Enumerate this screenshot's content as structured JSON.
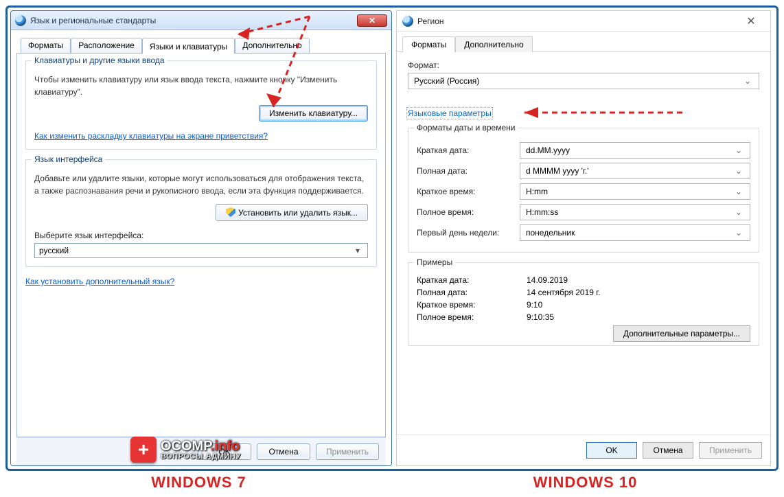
{
  "win7": {
    "title": "Язык и региональные стандарты",
    "tabs": [
      "Форматы",
      "Расположение",
      "Языки и клавиатуры",
      "Дополнительно"
    ],
    "active_tab_index": 2,
    "group_kb": {
      "legend": "Клавиатуры и другие языки ввода",
      "desc": "Чтобы изменить клавиатуру или язык ввода текста, нажмите кнопку \"Изменить клавиатуру\".",
      "btn": "Изменить клавиатуру...",
      "link": "Как изменить раскладку клавиатуры на экране приветствия?"
    },
    "group_ui": {
      "legend": "Язык интерфейса",
      "desc": "Добавьте или удалите языки, которые могут использоваться для отображения текста, а также распознавания речи и рукописного ввода, если эта функция поддерживается.",
      "btn": "Установить или удалить язык...",
      "select_label": "Выберите язык интерфейса:",
      "select_value": "русский"
    },
    "link_bottom": "Как установить дополнительный язык?",
    "footer": {
      "ok": "OK",
      "cancel": "Отмена",
      "apply": "Применить"
    }
  },
  "win10": {
    "title": "Регион",
    "tabs": [
      "Форматы",
      "Дополнительно"
    ],
    "active_tab_index": 0,
    "format_label": "Формат:",
    "format_value": "Русский (Россия)",
    "lang_params_link": "Языковые параметры",
    "group_dt": {
      "legend": "Форматы даты и времени",
      "rows": [
        {
          "label": "Краткая дата:",
          "value": "dd.MM.yyyy"
        },
        {
          "label": "Полная дата:",
          "value": "d MMMM yyyy 'г.'"
        },
        {
          "label": "Краткое время:",
          "value": "H:mm"
        },
        {
          "label": "Полное время:",
          "value": "H:mm:ss"
        },
        {
          "label": "Первый день недели:",
          "value": "понедельник"
        }
      ]
    },
    "group_ex": {
      "legend": "Примеры",
      "rows": [
        {
          "label": "Краткая дата:",
          "value": "14.09.2019"
        },
        {
          "label": "Полная дата:",
          "value": "14 сентября 2019 г."
        },
        {
          "label": "Краткое время:",
          "value": "9:10"
        },
        {
          "label": "Полное время:",
          "value": "9:10:35"
        }
      ]
    },
    "addl_btn": "Дополнительные параметры...",
    "footer": {
      "ok": "OK",
      "cancel": "Отмена",
      "apply": "Применить"
    }
  },
  "ocomp": {
    "line1a": "OCOMP",
    "line1b": ".info",
    "line2": "ВОПРОСЫ АДМИНУ"
  },
  "captions": {
    "left": "WINDOWS 7",
    "right": "WINDOWS 10"
  }
}
